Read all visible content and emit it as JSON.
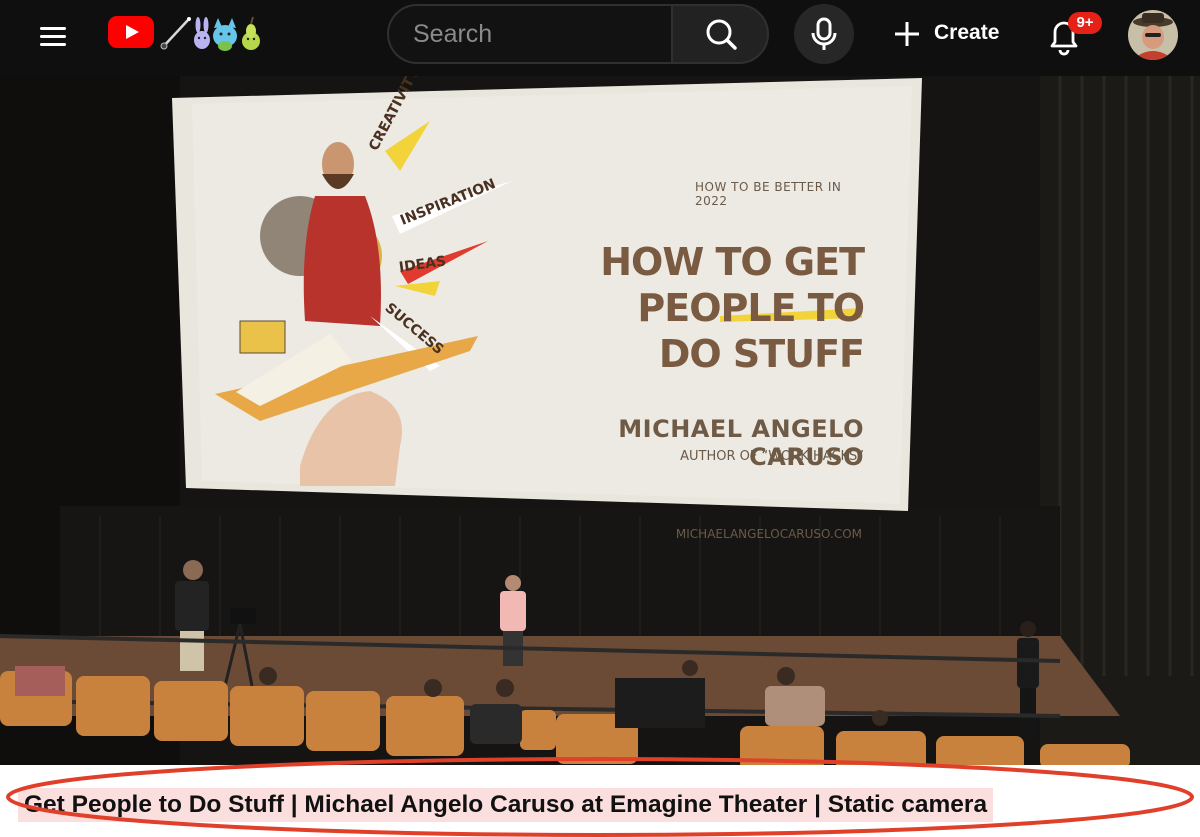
{
  "header": {
    "menu_icon": "hamburger-menu-icon",
    "logo_icon": "youtube-logo-icon",
    "search_placeholder": "Search",
    "search_icon": "search-icon",
    "mic_icon": "microphone-icon",
    "create_label": "Create",
    "notifications_badge": "9+",
    "avatar_icon": "user-avatar"
  },
  "video": {
    "slide": {
      "kicker": "HOW TO BE BETTER IN 2022",
      "headline": "HOW TO GET PEOPLE TO DO STUFF",
      "name": "MICHAEL ANGELO CARUSO",
      "author_line": "AUTHOR OF “WORK HACKS”",
      "url": "MICHAELANGELOCARUSO.COM",
      "words": [
        "CREATIVITY",
        "INSPIRATION",
        "IDEAS",
        "SUCCESS"
      ]
    }
  },
  "caption": {
    "text": "Get People to Do Stuff | Michael Angelo Caruso at Emagine Theater | Static camera"
  },
  "colors": {
    "bar": "#0f0f0f",
    "badge": "#e62117",
    "caption_highlight": "#fbdede",
    "ring": "#e0402a"
  }
}
